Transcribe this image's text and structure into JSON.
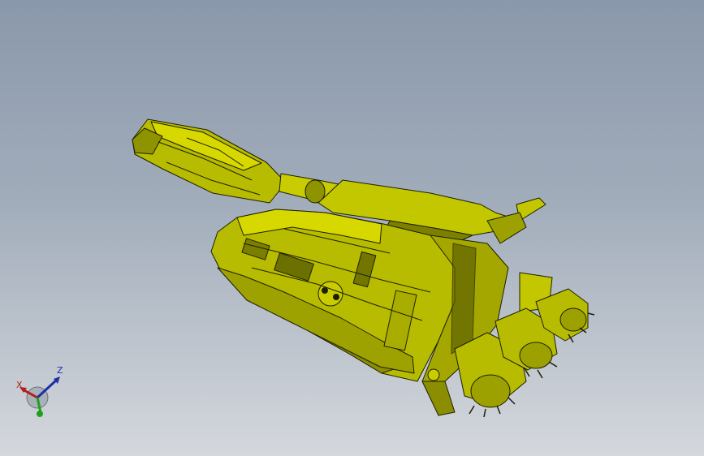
{
  "viewport": {
    "background_top": "#8a98ab",
    "background_bottom": "#d4d8dd"
  },
  "model": {
    "color_primary": "#b7bc00",
    "color_light": "#d6d800",
    "color_dark": "#5e6000",
    "outline": "#1e1f00"
  },
  "triad": {
    "x_label": "X",
    "z_label": "Z",
    "x_color": "#b51e1e",
    "y_color": "#1fa01f",
    "z_color": "#1c2fa8"
  }
}
